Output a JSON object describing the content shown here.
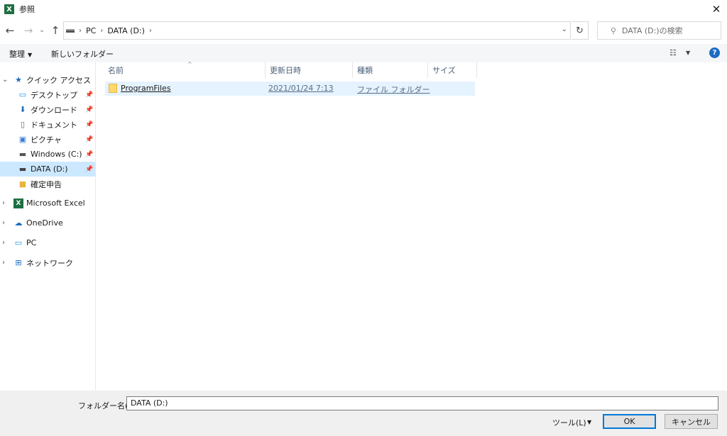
{
  "window": {
    "title": "参照",
    "app_icon_letter": "X",
    "close_glyph": "✕"
  },
  "address": {
    "crumbs": [
      "PC",
      "DATA (D:)"
    ],
    "search_placeholder": "DATA (D:)の検索"
  },
  "toolbar": {
    "organize": "整理",
    "new_folder": "新しいフォルダー"
  },
  "nav": {
    "items": [
      {
        "label": "クイック アクセス"
      },
      {
        "label": "デスクトップ"
      },
      {
        "label": "ダウンロード"
      },
      {
        "label": "ドキュメント"
      },
      {
        "label": "ピクチャ"
      },
      {
        "label": "Windows (C:)"
      },
      {
        "label": "DATA (D:)"
      },
      {
        "label": "確定申告"
      },
      {
        "label": "Microsoft Excel"
      },
      {
        "label": "OneDrive"
      },
      {
        "label": "PC"
      },
      {
        "label": "ネットワーク"
      }
    ]
  },
  "columns": {
    "name": "名前",
    "date": "更新日時",
    "type": "種類",
    "size": "サイズ"
  },
  "files": [
    {
      "name": "ProgramFiles",
      "date": "2021/01/24 7:13",
      "type": "ファイル フォルダー",
      "size": ""
    }
  ],
  "footer": {
    "folder_name_label": "フォルダー名(N):",
    "folder_name_value": "DATA (D:)",
    "tools": "ツール(L)",
    "ok": "OK",
    "cancel": "キャンセル"
  },
  "colors": {
    "selection": "#cce8ff",
    "row_hover": "#e5f3ff",
    "accent": "#0078d7",
    "excel_green": "#1d6f42"
  }
}
